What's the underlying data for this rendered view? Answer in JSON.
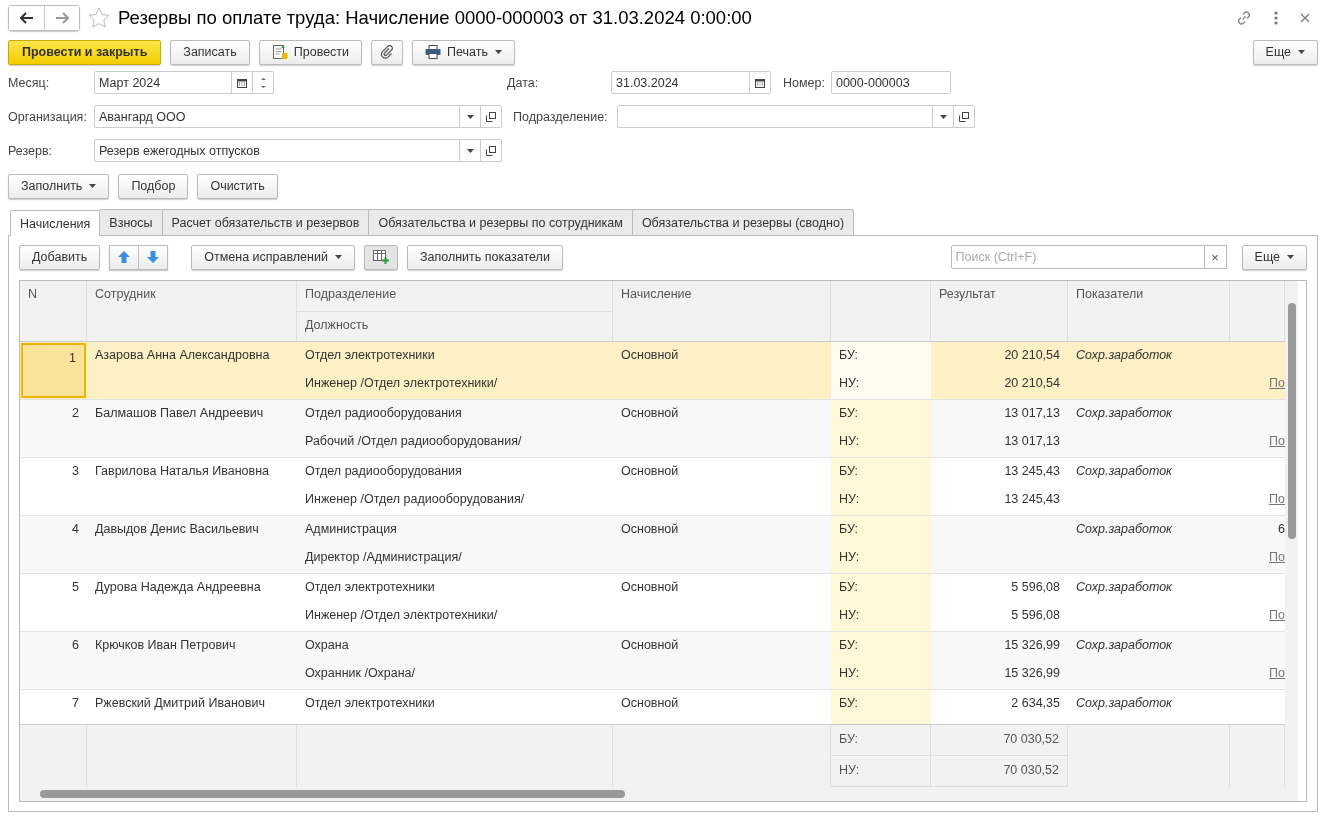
{
  "window": {
    "title": "Резервы по оплате труда: Начисление 0000-000003 от 31.03.2024 0:00:00"
  },
  "toolbar": {
    "post_and_close": "Провести и закрыть",
    "save": "Записать",
    "post": "Провести",
    "print": "Печать",
    "more": "Еще"
  },
  "fields": {
    "month": {
      "label": "Месяц:",
      "value": "Март 2024"
    },
    "date": {
      "label": "Дата:",
      "value": "31.03.2024"
    },
    "number": {
      "label": "Номер:",
      "value": "0000-000003"
    },
    "organization": {
      "label": "Организация:",
      "value": "Авангард ООО"
    },
    "department": {
      "label": "Подразделение:"
    },
    "reserve": {
      "label": "Резерв:",
      "value": "Резерв ежегодных отпусков"
    }
  },
  "actions": {
    "fill": "Заполнить",
    "pick": "Подбор",
    "clear": "Очистить"
  },
  "tabs": [
    {
      "label": "Начисления",
      "selected": true
    },
    {
      "label": "Взносы",
      "selected": false
    },
    {
      "label": "Расчет обязательств и резервов",
      "selected": false
    },
    {
      "label": "Обязательства и резервы по сотрудникам",
      "selected": false
    },
    {
      "label": "Обязательства и резервы (сводно)",
      "selected": false
    }
  ],
  "table_toolbar": {
    "add": "Добавить",
    "undo_corrections": "Отмена исправлений",
    "fill_indicators": "Заполнить показатели",
    "search": {
      "placeholder": "Поиск (Ctrl+F)",
      "clear": "×"
    },
    "more": "Еще"
  },
  "table": {
    "columns": {
      "n": "N",
      "employee": "Сотрудник",
      "department": "Подразделение",
      "position": "Должность",
      "accrual": "Начисление",
      "result": "Результат",
      "indicators": "Показатели"
    },
    "rows": [
      {
        "n": "1",
        "employee": "Азарова Анна Александровна",
        "department": "Отдел электротехники",
        "position": "Инженер /Отдел электротехники/",
        "accrual": "Основной",
        "bu_label": "БУ:",
        "nu_label": "НУ:",
        "bu": "20 210,54",
        "nu": "20 210,54",
        "indicator": "Сохр.заработок",
        "link": "По",
        "selected": true
      },
      {
        "n": "2",
        "employee": "Балмашов Павел Андреевич",
        "department": "Отдел радиооборудования",
        "position": "Рабочий /Отдел радиооборудования/",
        "accrual": "Основной",
        "bu_label": "БУ:",
        "nu_label": "НУ:",
        "bu": "13 017,13",
        "nu": "13 017,13",
        "indicator": "Сохр.заработок",
        "link": "По",
        "selected": false
      },
      {
        "n": "3",
        "employee": "Гаврилова Наталья Ивановна",
        "department": "Отдел радиооборудования",
        "position": "Инженер /Отдел радиооборудования/",
        "accrual": "Основной",
        "bu_label": "БУ:",
        "nu_label": "НУ:",
        "bu": "13 245,43",
        "nu": "13 245,43",
        "indicator": "Сохр.заработок",
        "link": "По",
        "selected": false
      },
      {
        "n": "4",
        "employee": "Давыдов Денис Васильевич",
        "department": "Администрация",
        "position": "Директор /Администрация/",
        "accrual": "Основной",
        "bu_label": "БУ:",
        "nu_label": "НУ:",
        "indicator": "Сохр.заработок",
        "extra": "6",
        "link": "По",
        "selected": false
      },
      {
        "n": "5",
        "employee": "Дурова Надежда Андреевна",
        "department": "Отдел электротехники",
        "position": "Инженер /Отдел электротехники/",
        "accrual": "Основной",
        "bu_label": "БУ:",
        "nu_label": "НУ:",
        "bu": "5 596,08",
        "nu": "5 596,08",
        "indicator": "Сохр.заработок",
        "link": "По",
        "selected": false
      },
      {
        "n": "6",
        "employee": "Крючков Иван Петрович",
        "department": "Охрана",
        "position": "Охранник /Охрана/",
        "accrual": "Основной",
        "bu_label": "БУ:",
        "nu_label": "НУ:",
        "bu": "15 326,99",
        "nu": "15 326,99",
        "indicator": "Сохр.заработок",
        "link": "По",
        "selected": false
      },
      {
        "n": "7",
        "employee": "Ржевский Дмитрий Иванович",
        "department": "Отдел электротехники",
        "accrual": "Основной",
        "bu_label": "БУ:",
        "bu": "2 634,35",
        "indicator": "Сохр.заработок",
        "selected": false
      }
    ],
    "totals": {
      "bu_label": "БУ:",
      "bu": "70 030,52",
      "nu_label": "НУ:",
      "nu": "70 030,52"
    }
  }
}
